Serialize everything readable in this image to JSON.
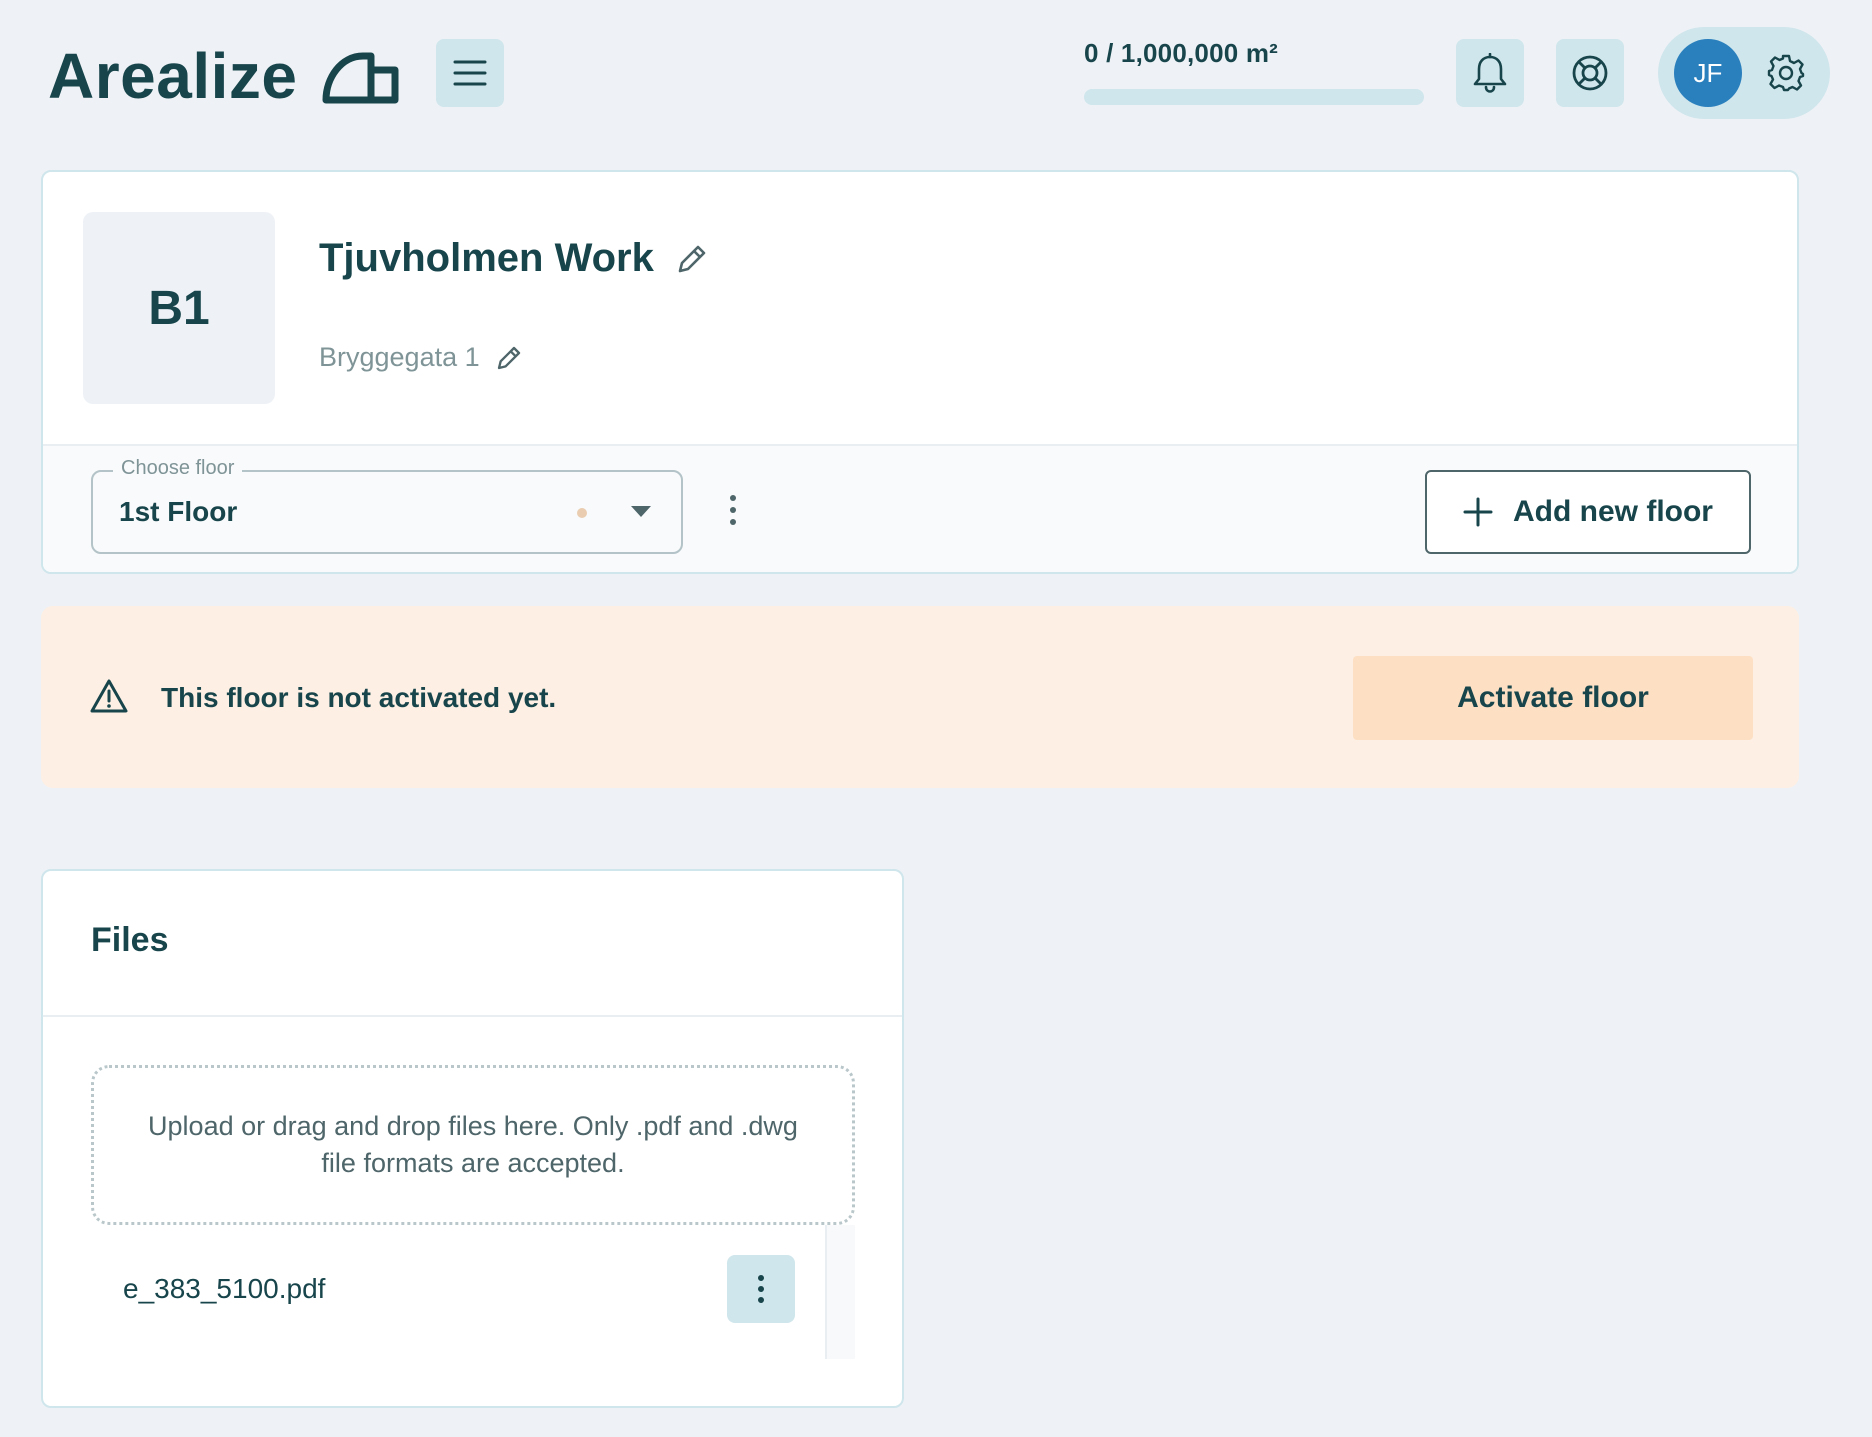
{
  "header": {
    "logo_text": "Arealize",
    "quota_text": "0 / 1,000,000 m²",
    "quota_fraction": 0,
    "avatar_initials": "JF"
  },
  "building": {
    "thumb_label": "B1",
    "name": "Tjuvholmen Work",
    "address": "Bryggegata 1"
  },
  "floor": {
    "legend": "Choose floor",
    "selected": "1st Floor",
    "add_label": "Add new floor"
  },
  "alert": {
    "message": "This floor is not activated yet.",
    "action_label": "Activate floor"
  },
  "files": {
    "title": "Files",
    "dropzone_text": "Upload or drag and drop files here. Only .pdf and .dwg file formats are accepted.",
    "items": [
      {
        "name": "e_383_5100.pdf"
      }
    ]
  },
  "colors": {
    "brand": "#17454b",
    "accent_bg": "#cfe6ec",
    "avatar": "#2a7fbd",
    "alert_bg": "#fdefe3",
    "alert_button": "#fde0c4",
    "page_bg": "#eef2f6"
  },
  "icons": {
    "logo": "building-logo-icon",
    "menu": "hamburger-menu-icon",
    "bell": "bell-icon",
    "help": "lifebuoy-icon",
    "settings": "gear-icon",
    "edit": "pencil-icon",
    "more": "kebab-icon",
    "add": "plus-icon",
    "warning": "warning-triangle-icon",
    "dropdown": "caret-down-icon"
  }
}
